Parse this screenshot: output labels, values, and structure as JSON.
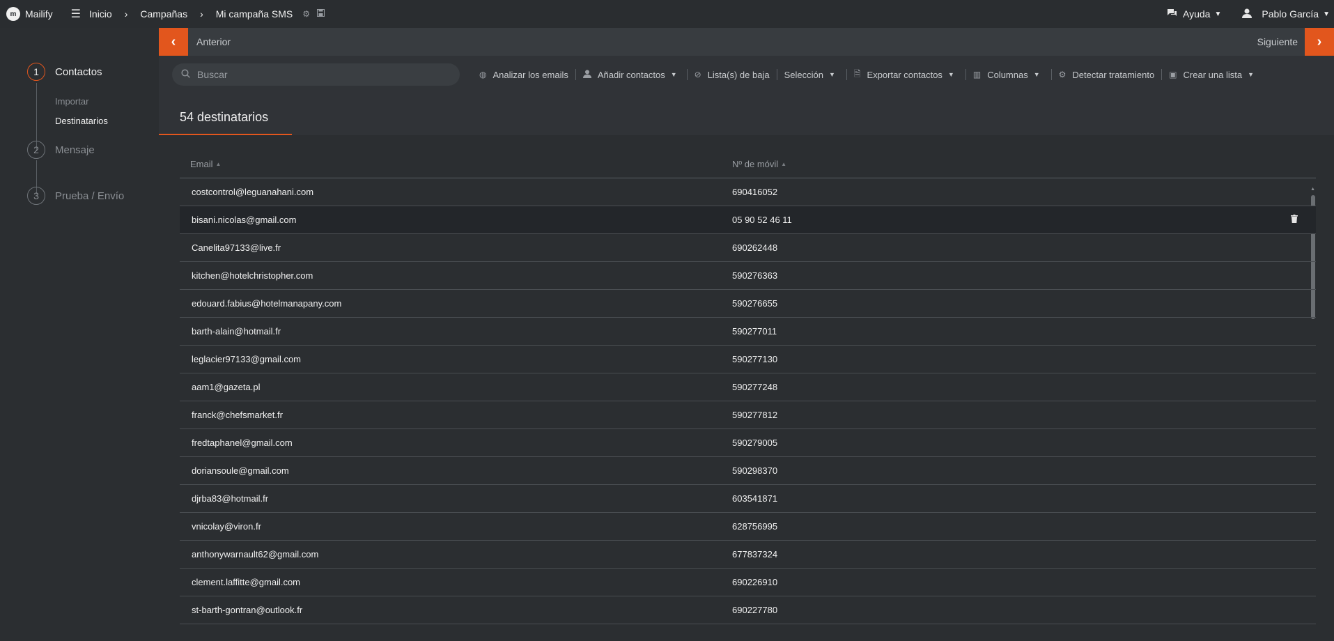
{
  "app": {
    "name": "Mailify",
    "logo_glyph": "m"
  },
  "breadcrumb": {
    "items": [
      "Inicio",
      "Campañas",
      "Mi campaña SMS"
    ],
    "separator": "›"
  },
  "header_right": {
    "help_label": "Ayuda",
    "user_name": "Pablo García"
  },
  "sidebar": {
    "steps": [
      {
        "number": "1",
        "label": "Contactos"
      },
      {
        "number": "2",
        "label": "Mensaje"
      },
      {
        "number": "3",
        "label": "Prueba / Envío"
      }
    ],
    "sub_items": [
      "Importar",
      "Destinatarios"
    ]
  },
  "nav": {
    "prev_label": "Anterior",
    "next_label": "Siguiente"
  },
  "toolbar": {
    "search_placeholder": "Buscar",
    "analyze_label": "Analizar los emails",
    "add_contacts_label": "Añadir contactos",
    "unsubscribe_label": "Lista(s) de baja",
    "selection_label": "Selección",
    "export_label": "Exportar contactos",
    "columns_label": "Columnas",
    "detect_label": "Detectar tratamiento",
    "create_list_label": "Crear una lista"
  },
  "section": {
    "title": "54 destinatarios"
  },
  "table": {
    "columns": [
      "Email",
      "Nº de móvil"
    ],
    "rows": [
      {
        "email": "costcontrol@leguanahani.com",
        "phone": "690416052"
      },
      {
        "email": "bisani.nicolas@gmail.com",
        "phone": "05 90 52 46 11"
      },
      {
        "email": "Canelita97133@live.fr",
        "phone": "690262448"
      },
      {
        "email": "kitchen@hotelchristopher.com",
        "phone": "590276363"
      },
      {
        "email": "edouard.fabius@hotelmanapany.com",
        "phone": "590276655"
      },
      {
        "email": "barth-alain@hotmail.fr",
        "phone": "590277011"
      },
      {
        "email": "leglacier97133@gmail.com",
        "phone": "590277130"
      },
      {
        "email": "aam1@gazeta.pl",
        "phone": "590277248"
      },
      {
        "email": "franck@chefsmarket.fr",
        "phone": "590277812"
      },
      {
        "email": "fredtaphanel@gmail.com",
        "phone": "590279005"
      },
      {
        "email": "doriansoule@gmail.com",
        "phone": "590298370"
      },
      {
        "email": "djrba83@hotmail.fr",
        "phone": "603541871"
      },
      {
        "email": "vnicolay@viron.fr",
        "phone": "628756995"
      },
      {
        "email": "anthonywarnault62@gmail.com",
        "phone": "677837324"
      },
      {
        "email": "clement.laffitte@gmail.com",
        "phone": "690226910"
      },
      {
        "email": "st-barth-gontran@outlook.fr",
        "phone": "690227780"
      }
    ]
  },
  "colors": {
    "accent": "#e2561d",
    "background": "#2b2e31",
    "toolbar": "#303337",
    "navbar": "#383c40"
  }
}
